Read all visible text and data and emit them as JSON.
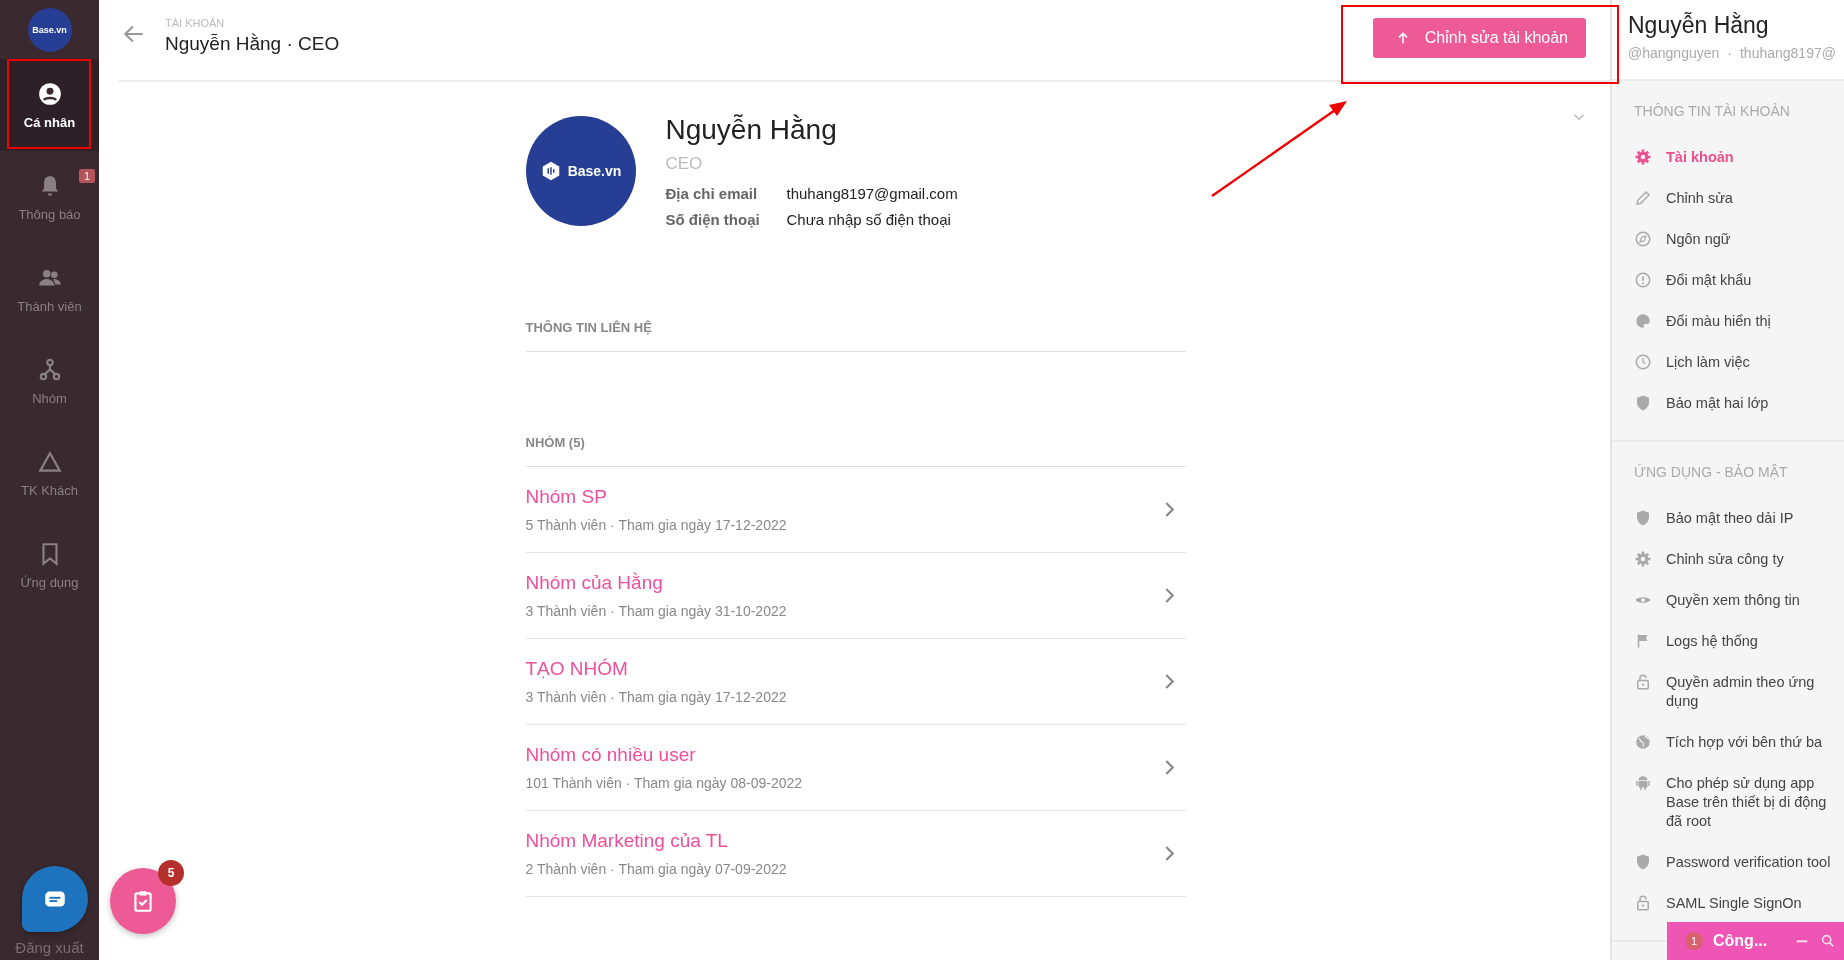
{
  "nav": {
    "logo": "Base.vn",
    "items": [
      {
        "label": "Cá nhân",
        "kind": "user",
        "selected": true
      },
      {
        "label": "Thông báo",
        "kind": "bell",
        "selected": false,
        "badge": "1"
      },
      {
        "label": "Thành viên",
        "kind": "people",
        "selected": false
      },
      {
        "label": "Nhóm",
        "kind": "network",
        "selected": false
      },
      {
        "label": "TK Khách",
        "kind": "triangle",
        "selected": false
      },
      {
        "label": "Ứng dụng",
        "kind": "bookmark",
        "selected": false
      }
    ],
    "logout": "Đăng xuất"
  },
  "header": {
    "eyebrow": "TÀI KHOẢN",
    "title": "Nguyễn Hằng · CEO",
    "edit_button": "Chỉnh sửa tài khoản"
  },
  "profile": {
    "avatar": "Base.vn",
    "name": "Nguyễn Hằng",
    "role": "CEO",
    "fields": [
      {
        "label": "Địa chỉ email",
        "value": "thuhang8197@gmail.com"
      },
      {
        "label": "Số điện thoại",
        "value": "Chưa nhập số điện thoại"
      }
    ]
  },
  "contact": {
    "heading": "THÔNG TIN LIÊN HỆ"
  },
  "groups": {
    "heading": "NHÓM (5)",
    "items": [
      {
        "name": "Nhóm SP",
        "meta": "5 Thành viên · Tham gia ngày 17-12-2022"
      },
      {
        "name": "Nhóm của Hằng",
        "meta": "3 Thành viên · Tham gia ngày 31-10-2022"
      },
      {
        "name": "TẠO NHÓM",
        "meta": "3 Thành viên · Tham gia ngày 17-12-2022"
      },
      {
        "name": "Nhóm có nhiều user",
        "meta": "101 Thành viên · Tham gia ngày 08-09-2022"
      },
      {
        "name": "Nhóm Marketing của TL",
        "meta": "2 Thành viên · Tham gia ngày 07-09-2022"
      }
    ]
  },
  "task_button": {
    "badge": "5"
  },
  "side": {
    "name": "Nguyễn Hằng",
    "handle": "@hangnguyen",
    "separator": "·",
    "email": "thuhang8197@",
    "sections": [
      {
        "heading": "THÔNG TIN TÀI KHOẢN",
        "items": [
          {
            "label": "Tài khoản",
            "kind": "gear",
            "selected": true
          },
          {
            "label": "Chỉnh sửa",
            "kind": "pencil",
            "selected": false
          },
          {
            "label": "Ngôn ngữ",
            "kind": "compass",
            "selected": false
          },
          {
            "label": "Đổi mật khẩu",
            "kind": "alert",
            "selected": false
          },
          {
            "label": "Đổi màu hiển thị",
            "kind": "palette",
            "selected": false
          },
          {
            "label": "Lịch làm việc",
            "kind": "clock",
            "selected": false
          },
          {
            "label": "Bảo mật hai lớp",
            "kind": "shield",
            "selected": false
          }
        ]
      },
      {
        "heading": "ỨNG DỤNG - BẢO MẬT",
        "items": [
          {
            "label": "Bảo mật theo dải IP",
            "kind": "shield",
            "selected": false
          },
          {
            "label": "Chỉnh sửa công ty",
            "kind": "gear",
            "selected": false
          },
          {
            "label": "Quyền xem thông tin",
            "kind": "eye",
            "selected": false
          },
          {
            "label": "Logs hệ thống",
            "kind": "flag",
            "selected": false
          },
          {
            "label": "Quyền admin theo ứng dụng",
            "kind": "lock",
            "selected": false
          },
          {
            "label": "Tích hợp với bên thứ ba",
            "kind": "globe",
            "selected": false
          },
          {
            "label": "Cho phép sử dụng app Base trên thiết bị di động đã root",
            "kind": "android",
            "selected": false
          },
          {
            "label": "Password verification tool",
            "kind": "shield",
            "selected": false
          },
          {
            "label": "SAML Single SignOn",
            "kind": "lock",
            "selected": false
          }
        ]
      }
    ]
  },
  "chat_bar": {
    "count": "1",
    "title": "Công..."
  }
}
